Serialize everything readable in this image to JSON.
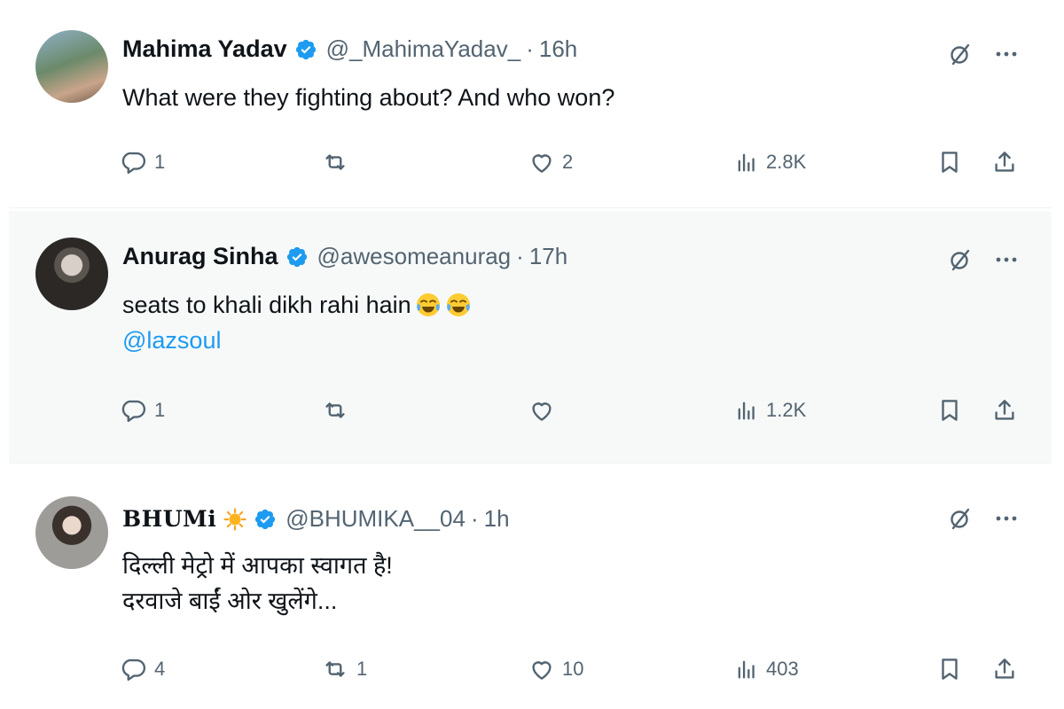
{
  "tweets": [
    {
      "name": "Mahima Yadav",
      "handle": "@_MahimaYadav_",
      "separator": "·",
      "time": "16h",
      "text_lines": [
        "What were they fighting about? And who won?"
      ],
      "mention": "",
      "stats": {
        "replies": "1",
        "retweets": "",
        "likes": "2",
        "views": "2.8K"
      }
    },
    {
      "name": "Anurag Sinha",
      "handle": "@awesomeanurag",
      "separator": "·",
      "time": "17h",
      "text_lines": [
        "seats to khali dikh rahi hain"
      ],
      "emojis": [
        "face-with-tears-of-joy",
        "face-with-tears-of-joy"
      ],
      "mention": "@lazsoul",
      "stats": {
        "replies": "1",
        "retweets": "",
        "likes": "",
        "views": "1.2K"
      }
    },
    {
      "name": "BHUMi",
      "name_badge": "sun-emoji",
      "handle": "@BHUMIKA__04",
      "separator": "·",
      "time": "1h",
      "text_lines": [
        "दिल्ली मेट्रो में आपका स्वागत है!",
        "दरवाजे बाईं ओर खुलेंगे..."
      ],
      "mention": "",
      "stats": {
        "replies": "4",
        "retweets": "1",
        "likes": "10",
        "views": "403"
      }
    }
  ],
  "icons": {
    "verified": "verified-badge-icon",
    "grok": "grok-icon",
    "more": "more-icon",
    "reply": "reply-icon",
    "retweet": "retweet-icon",
    "like": "like-icon",
    "views": "views-icon",
    "bookmark": "bookmark-icon",
    "share": "share-icon"
  },
  "colors": {
    "text": "#0f1419",
    "secondary": "#536471",
    "link": "#1d9bf0",
    "verified": "#1d9bf0",
    "highlight_bg": "#f7f9f9"
  }
}
